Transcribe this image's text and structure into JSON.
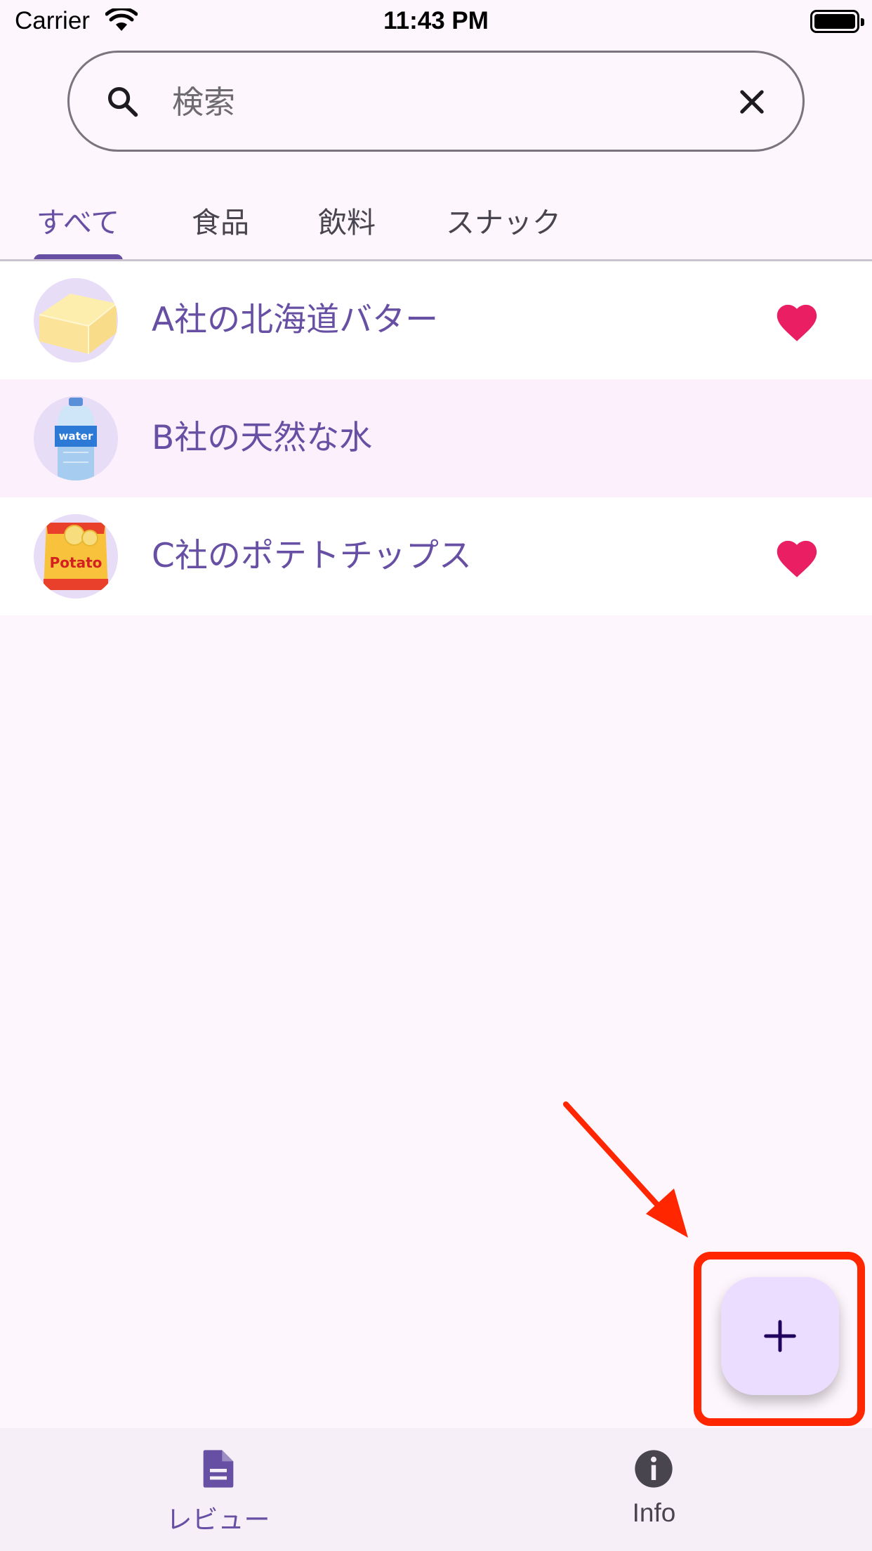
{
  "status_bar": {
    "carrier": "Carrier",
    "time": "11:43 PM"
  },
  "search": {
    "placeholder": "検索",
    "value": ""
  },
  "tabs": [
    {
      "label": "すべて",
      "active": true
    },
    {
      "label": "食品",
      "active": false
    },
    {
      "label": "飲料",
      "active": false
    },
    {
      "label": "スナック",
      "active": false
    }
  ],
  "products": [
    {
      "name": "A社の北海道バター",
      "icon": "butter-image",
      "favorite": true
    },
    {
      "name": "B社の天然な水",
      "icon": "water-bottle-image",
      "favorite": false
    },
    {
      "name": "C社のポテトチップス",
      "icon": "potato-chips-image",
      "favorite": true
    }
  ],
  "fab": {
    "icon": "plus-icon"
  },
  "bottom_nav": [
    {
      "label": "レビュー",
      "icon": "document-icon",
      "active": true
    },
    {
      "label": "Info",
      "icon": "info-icon",
      "active": false
    }
  ],
  "colors": {
    "background": "#fdf6fd",
    "primary": "#6750a4",
    "heart": "#e91e63",
    "fab": "#eaddff",
    "annotation": "#ff2600"
  }
}
